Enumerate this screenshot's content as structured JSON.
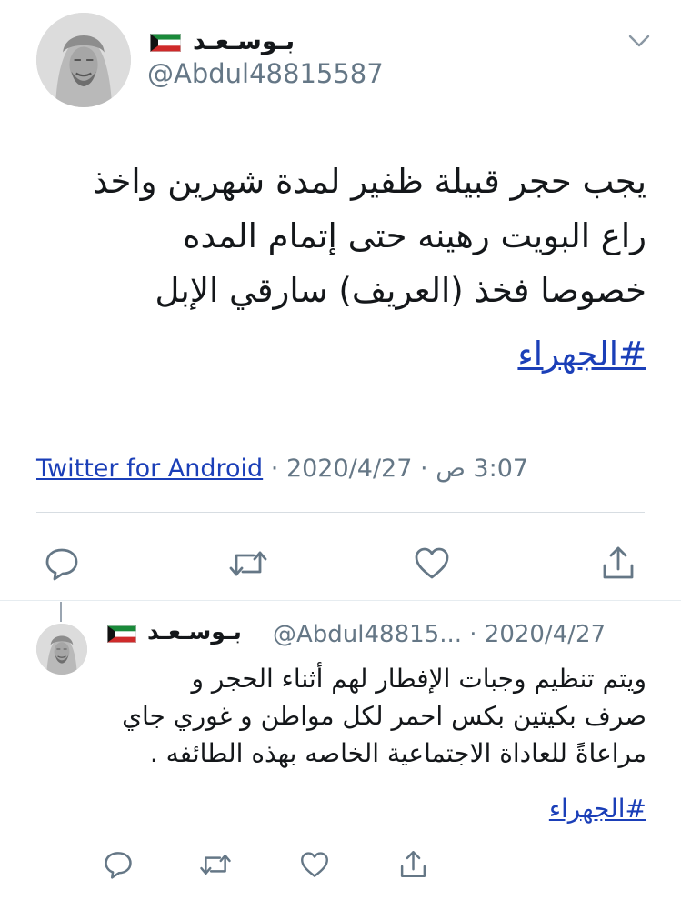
{
  "main_tweet": {
    "display_name": "بـوسـعـد",
    "handle": "@Abdul48815587",
    "lines": [
      "يجب حجر قبيلة ظفير لمدة شهرين واخذ",
      "راع البويت رهينه حتى إتمام المده",
      "خصوصا فخذ (العريف) سارقي الإبل"
    ],
    "hashtag": "#الجهراء",
    "time": "3:07 ص",
    "date": "2020/4/27",
    "separator": "·",
    "source": "Twitter for Android"
  },
  "reply": {
    "display_name": "بـوسـعـد",
    "handle": "@Abdul48815...",
    "separator": "·",
    "date": "2020/4/27",
    "lines": [
      "ويتم تنظيم وجبات الإفطار لهم أثناء الحجر و",
      "صرف بكيتين بكس احمر لكل مواطن و غوري جاي",
      "مراعاةً للعاداة الاجتماعية الخاصه بهذه الطائفه ."
    ],
    "hashtag": "#الجهراء"
  },
  "icons": {
    "caret": "chevron-down-icon",
    "reply": "reply-icon",
    "retweet": "retweet-icon",
    "like": "heart-icon",
    "share": "share-icon",
    "flag": "kuwait-flag-icon"
  },
  "colors": {
    "link": "#1b3fb8",
    "secondary_text": "#657786",
    "icon": "#657786",
    "divider": "#d7dde2"
  }
}
